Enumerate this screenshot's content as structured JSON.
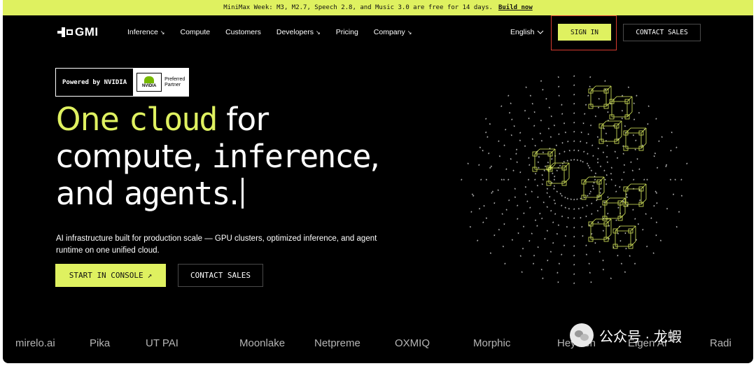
{
  "promo": {
    "text": "MiniMax Week: M3, M2.7, Speech 2.8, and Music 3.0 are free for 14 days.",
    "link": "Build now"
  },
  "nav": {
    "logo": "GMI",
    "items": [
      {
        "label": "Inference",
        "dropdown": true
      },
      {
        "label": "Compute",
        "dropdown": false
      },
      {
        "label": "Customers",
        "dropdown": false
      },
      {
        "label": "Developers",
        "dropdown": true
      },
      {
        "label": "Pricing",
        "dropdown": false
      },
      {
        "label": "Company",
        "dropdown": true
      }
    ],
    "language": "English",
    "sign_in": "SIGN IN",
    "contact_sales": "CONTACT SALES"
  },
  "badge": {
    "powered": "Powered by NVIDIA",
    "brand": "NVIDIA",
    "partner_line1": "Preferred",
    "partner_line2": "Partner"
  },
  "hero": {
    "w1": "One",
    "w2": "cloud",
    "w3": "for",
    "line2a": "compute, ",
    "line2b": "inference",
    "line2c": ",",
    "line3a": "and ",
    "line3b": "agents",
    "line3c": "."
  },
  "subtitle": "AI infrastructure built for production scale — GPU clusters, optimized inference, and agent runtime on one unified cloud.",
  "cta": {
    "primary": "START IN CONSOLE",
    "primary_icon": "↗",
    "secondary": "CONTACT SALES"
  },
  "logos": [
    "mirelo.ai",
    "Pika",
    "UT PAI",
    "Moonlake",
    "Netpreme",
    "OXMIQ",
    "Morphic",
    "HeyGen",
    "Eigen AI",
    "Radi"
  ],
  "watermark": "公众号 · 龙蝦",
  "colors": {
    "accent": "#dff160",
    "background": "#000000",
    "highlight": "#d63b2f"
  }
}
